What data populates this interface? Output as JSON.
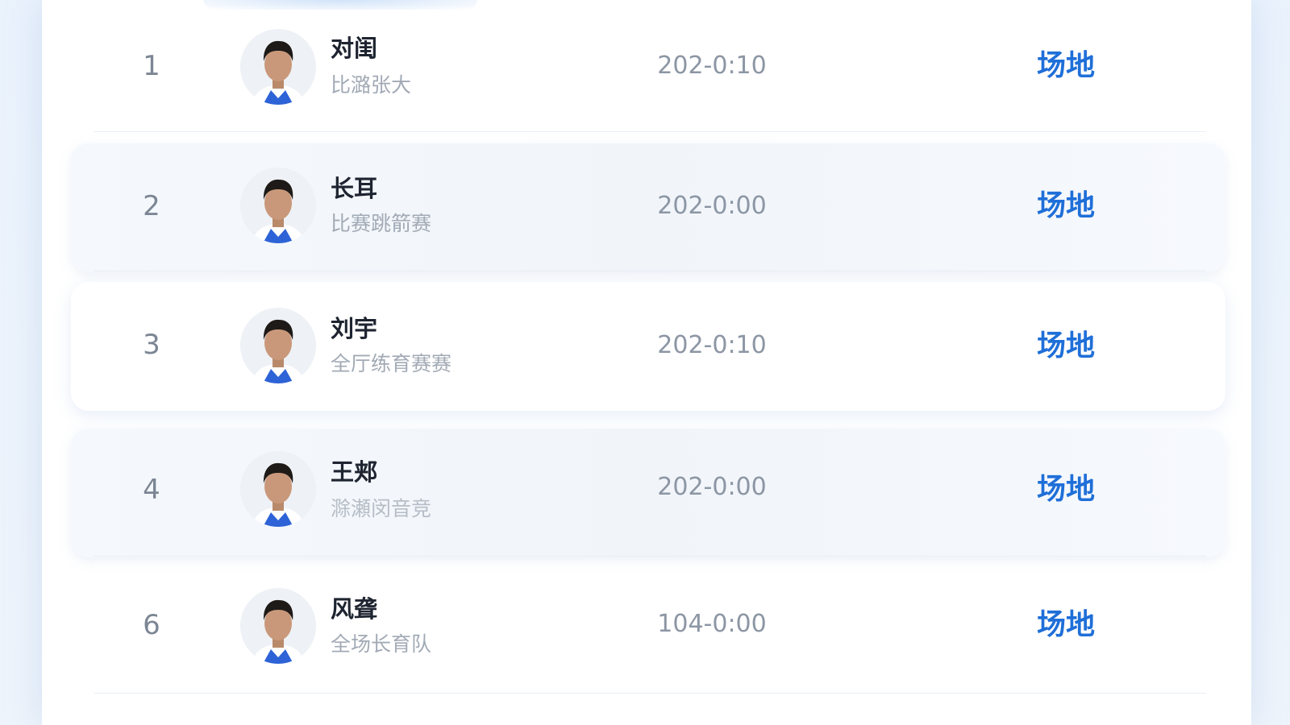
{
  "rows": [
    {
      "rank": "1",
      "name": "对闺",
      "subtitle": "比潞张大",
      "time": "202-0:10",
      "venue": "场地"
    },
    {
      "rank": "2",
      "name": "长耳",
      "subtitle": "比赛跳箭赛",
      "time": "202-0:00",
      "venue": "场地"
    },
    {
      "rank": "3",
      "name": "刘宇",
      "subtitle": "全厅练育赛赛",
      "time": "202-0:10",
      "venue": "场地"
    },
    {
      "rank": "4",
      "name": "王郏",
      "subtitle": "滁瀬闵音竞",
      "time": "202-0:00",
      "venue": "场地"
    },
    {
      "rank": "6",
      "name": "风聋",
      "subtitle": "全场长育队",
      "time": "104-0:00",
      "venue": "场地"
    }
  ],
  "colors": {
    "accent": "#1f6fd8",
    "name_text": "#1e2430",
    "muted_text": "#8c96a4",
    "jersey": "#2d63d6"
  },
  "icons": {
    "avatar": "player-avatar-photo"
  }
}
